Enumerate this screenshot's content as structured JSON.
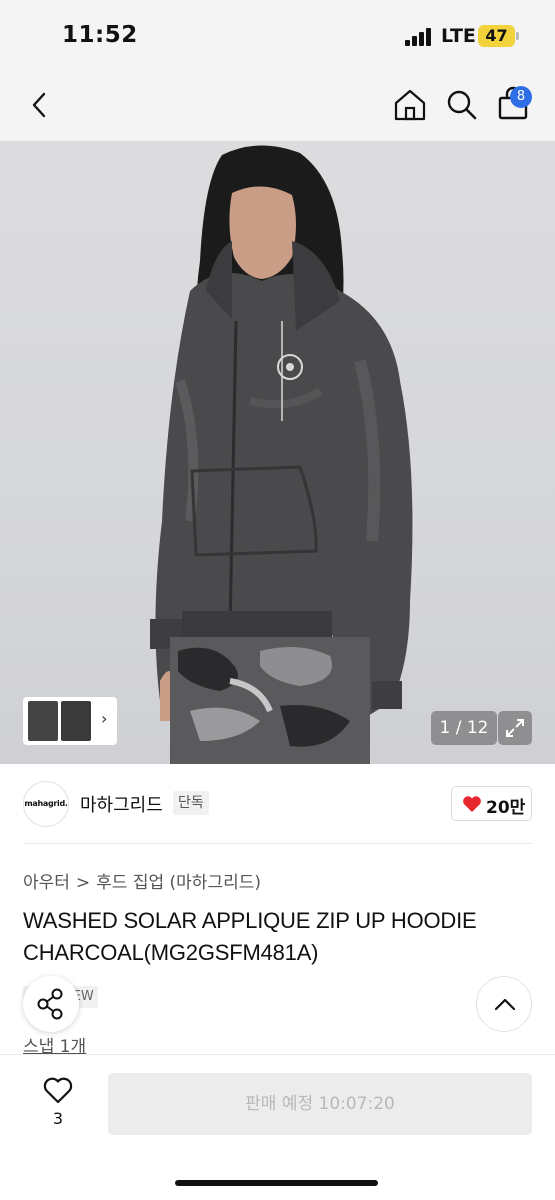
{
  "status_bar": {
    "time": "11:52",
    "network": "LTE",
    "battery": "47"
  },
  "nav": {
    "back_icon": "chevron-left-icon",
    "home_icon": "home-icon",
    "search_icon": "search-icon",
    "cart_icon": "shopping-bag-icon",
    "cart_badge": "8"
  },
  "gallery": {
    "page_counter": "1 / 12",
    "expand_icon": "expand-icon"
  },
  "brand": {
    "logo_text": "mahagrid.",
    "name": "마하그리드",
    "badge": "단독",
    "like_count": "20만",
    "like_color": "#e8262d"
  },
  "product": {
    "breadcrumb": [
      "아우터",
      "후드 집업 (마하그리드)"
    ],
    "breadcrumb_separator": ">",
    "title_line1": "WASHED SOLAR APPLIQUE ZIP UP HOODIE",
    "title_line2": "CHARCOAL(MG2GSFM481A)",
    "tags": [
      "단독",
      "NEW"
    ],
    "snap_link": "스냅 1개"
  },
  "bottom_bar": {
    "wish_count": "3",
    "buy_label": "판매 예정 10:07:20"
  }
}
